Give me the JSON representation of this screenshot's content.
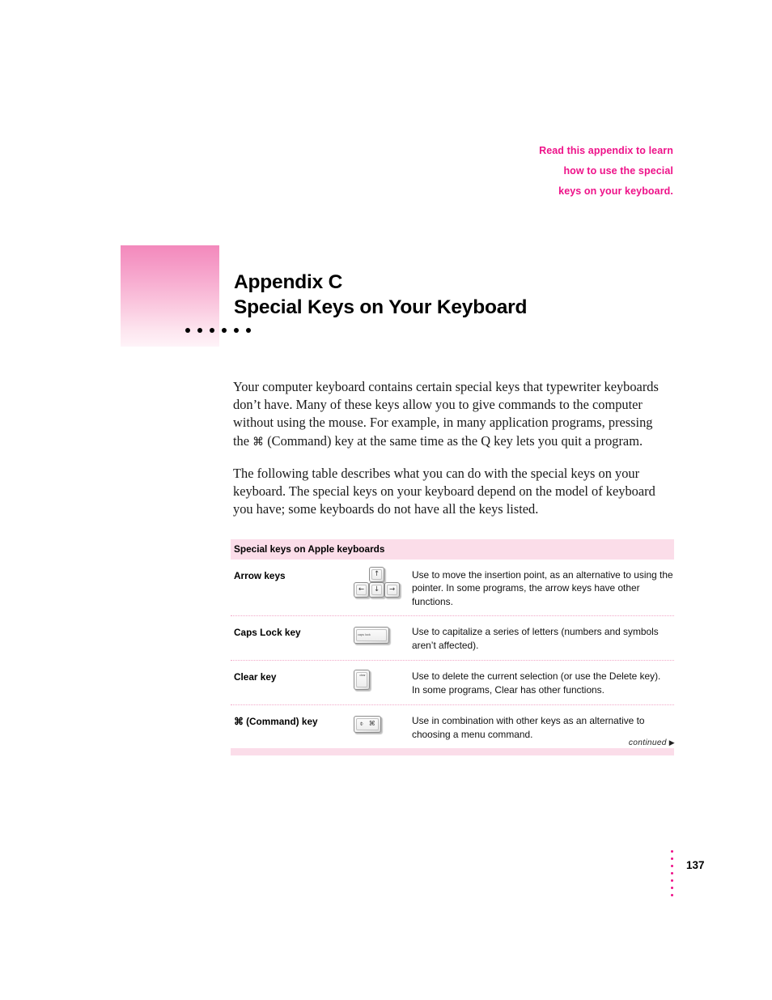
{
  "colors": {
    "accent_pink": "#ee1289",
    "band_pink": "#fbdde9",
    "swatch_top": "#f389bc",
    "rule_pink": "#f2a8c8"
  },
  "eyebrow": {
    "line1": "Read this appendix to learn",
    "line2": "how to use the special",
    "line3": "keys on your keyboard."
  },
  "title": {
    "appendix": "Appendix C",
    "name": "Special Keys on Your Keyboard",
    "dot_count": 6
  },
  "body": {
    "paragraph1": "Your computer keyboard contains certain special keys that typewriter keyboards don’t have. Many of these keys allow you to give commands to the computer without using the mouse. For example, in many application programs, pressing the ",
    "paragraph1_cmd": "⌘",
    "paragraph1_cont": " (Command) key at the same time as the Q key lets you quit a program.",
    "paragraph2": "The following table describes what you can do with the special keys on your keyboard. The special keys on your keyboard depend on the model of keyboard you have; some keyboards do not have all the keys listed."
  },
  "table": {
    "header": "Special keys on Apple keyboards",
    "rows": [
      {
        "name": "Arrow keys",
        "glyph": "arrow-key-cluster",
        "key_labels": {
          "up": "↑",
          "left": "←",
          "down": "↓",
          "right": "→"
        },
        "desc_line1": "Use to move the insertion point, as an alternative to using the",
        "desc_line2": "pointer. In some programs, the arrow keys have other functions."
      },
      {
        "name": "Caps Lock key",
        "glyph": "caps-lock-key",
        "key_label": "caps lock",
        "desc_line1": "Use to capitalize a series of letters (numbers and symbols",
        "desc_line2": "aren’t affected)."
      },
      {
        "name": "Clear key",
        "glyph": "clear-key",
        "key_label": "clear",
        "desc_line1": "Use to delete the current selection (or use the Delete key).",
        "desc_line2": "In some programs, Clear has other functions."
      },
      {
        "name": "⌘ (Command) key",
        "glyph": "command-key",
        "key_label_apple": "⌽",
        "key_label_cmd": "⌘",
        "desc_line1": "Use in combination with other keys as an alternative to",
        "desc_line2": "choosing a menu command."
      }
    ]
  },
  "footer": {
    "continued": "continued",
    "continued_arrow": "▶",
    "page_number": "137",
    "folio_dot_count": 7
  }
}
